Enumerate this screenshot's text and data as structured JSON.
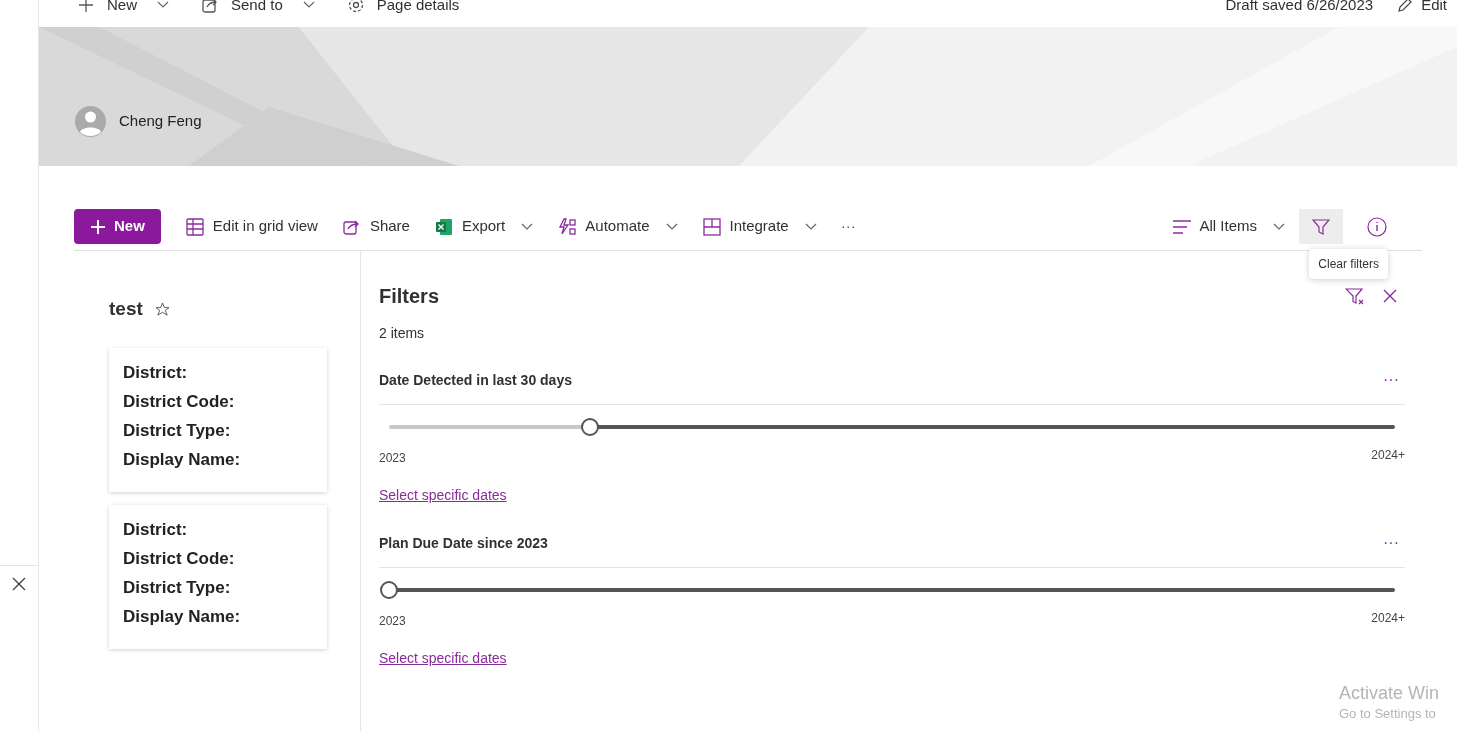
{
  "command_bar": {
    "items": [
      {
        "label": "New",
        "kind": "new",
        "dropdown": true
      },
      {
        "label": "Send to",
        "kind": "send",
        "dropdown": true
      },
      {
        "label": "Page details",
        "kind": "gear",
        "dropdown": false
      }
    ],
    "draft_status": "Draft saved 6/26/2023",
    "edit": "Edit"
  },
  "banner": {
    "author": "Cheng Feng"
  },
  "toolbar": {
    "new_button": "New",
    "items": [
      {
        "label": "Edit in grid view",
        "kind": "grid",
        "dropdown": false
      },
      {
        "label": "Share",
        "kind": "share",
        "dropdown": false
      },
      {
        "label": "Export",
        "kind": "excel",
        "dropdown": true
      },
      {
        "label": "Automate",
        "kind": "automate",
        "dropdown": true
      },
      {
        "label": "Integrate",
        "kind": "integrate",
        "dropdown": true
      }
    ],
    "more": "···",
    "view": "All Items",
    "filter_active": true,
    "tooltip": "Clear filters"
  },
  "list": {
    "title": "test",
    "cards": [
      {
        "fields": [
          "District:",
          "District Code:",
          "District Type:",
          "Display Name:"
        ]
      },
      {
        "fields": [
          "District:",
          "District Code:",
          "District Type:",
          "Display Name:"
        ]
      }
    ]
  },
  "filters": {
    "title": "Filters",
    "count": "2 items",
    "sections": [
      {
        "title": "Date Detected in last 30 days",
        "more": "···",
        "level": 0.2,
        "min": "2023",
        "max": "2024+",
        "link": "Select specific dates"
      },
      {
        "title": "Plan Due Date since 2023",
        "more": "···",
        "level": 0,
        "min": "2023",
        "max": "2024+",
        "link": "Select specific dates"
      }
    ]
  },
  "activation": {
    "title": "Activate Win",
    "subtitle": "Go to Settings to"
  }
}
